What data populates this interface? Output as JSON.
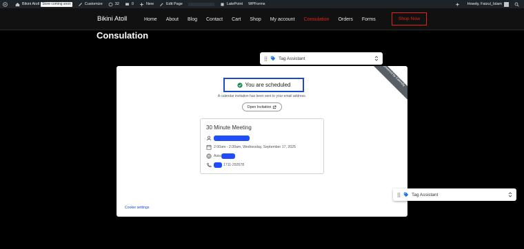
{
  "adminbar": {
    "site_name": "Bikini Atoll",
    "store_badge": "Store coming soon",
    "customize": "Customize",
    "updates_count": "32",
    "comments_count": "0",
    "new": "New",
    "edit_page": "Edit Page",
    "latepoint": "LatePoint",
    "wpforms": "WPForms",
    "howdy": "Howdy, Faizul_Islam"
  },
  "header": {
    "logo": "Bikini Atoll",
    "nav": [
      "Home",
      "About",
      "Blog",
      "Contact",
      "Cart",
      "Shop",
      "My account",
      "Consulation",
      "Orders",
      "Forms"
    ],
    "active_nav": "Consulation",
    "shop_now": "Shop Now"
  },
  "page": {
    "title": "Consulation"
  },
  "tag_assistant": {
    "label": "Tag Assistant"
  },
  "confirmation": {
    "ribbon": "powered by Calendly",
    "scheduled": "You are scheduled",
    "invite_text": "A calendar invitation has been sent to your email address.",
    "open_invitation": "Open Invitation",
    "meeting_title": "30 Minute Meeting",
    "time": "2:00am - 2:30am, Wednesday, September 17, 2025",
    "timezone_prefix": "Asia",
    "phone_suffix": "1711-292678",
    "cookie_settings": "Cookie settings"
  },
  "colors": {
    "accent": "#e2231a",
    "calendly_blue": "#1a48d1",
    "redaction": "#1f4dfc"
  }
}
